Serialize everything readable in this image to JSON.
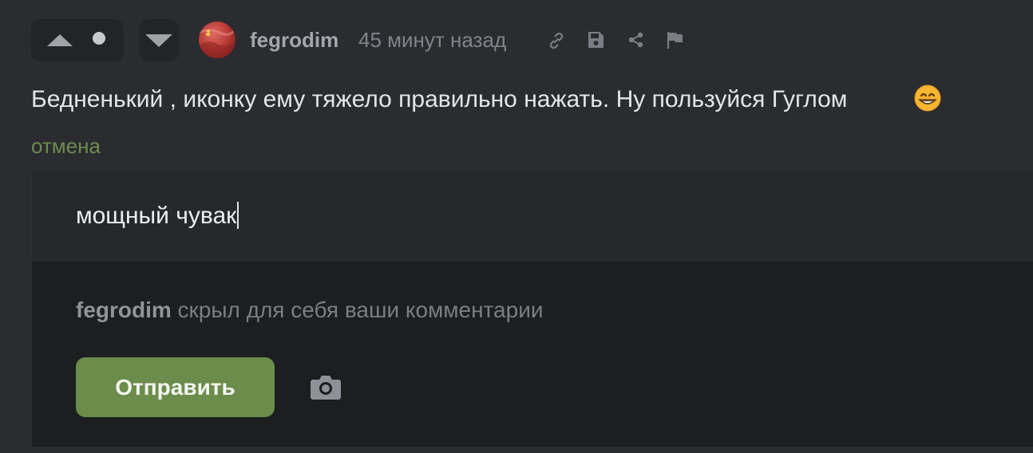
{
  "comment": {
    "author": "fegrodim",
    "time": "45 минут назад",
    "text": "Бедненький , иконку ему тяжело правильно нажать. Ну пользуйся Гуглом",
    "emoji": "grinning-face-emoji"
  },
  "actions": {
    "icons": [
      "upvote-icon",
      "rating-dot",
      "downvote-icon",
      "link-icon",
      "save-icon",
      "share-icon",
      "flag-icon"
    ]
  },
  "reply": {
    "cancel_label": "отмена",
    "input_value": "мощный чувак",
    "notice_user": "fegrodim",
    "notice_text": " скрыл для себя ваши комментарии",
    "send_label": "Отправить",
    "camera_icon": "camera-icon"
  },
  "colors": {
    "background": "#2a2c30",
    "accent_green": "#6b8c4a",
    "link_green": "#6f8c4f",
    "text": "#e3e5e8",
    "muted": "#80848a"
  }
}
